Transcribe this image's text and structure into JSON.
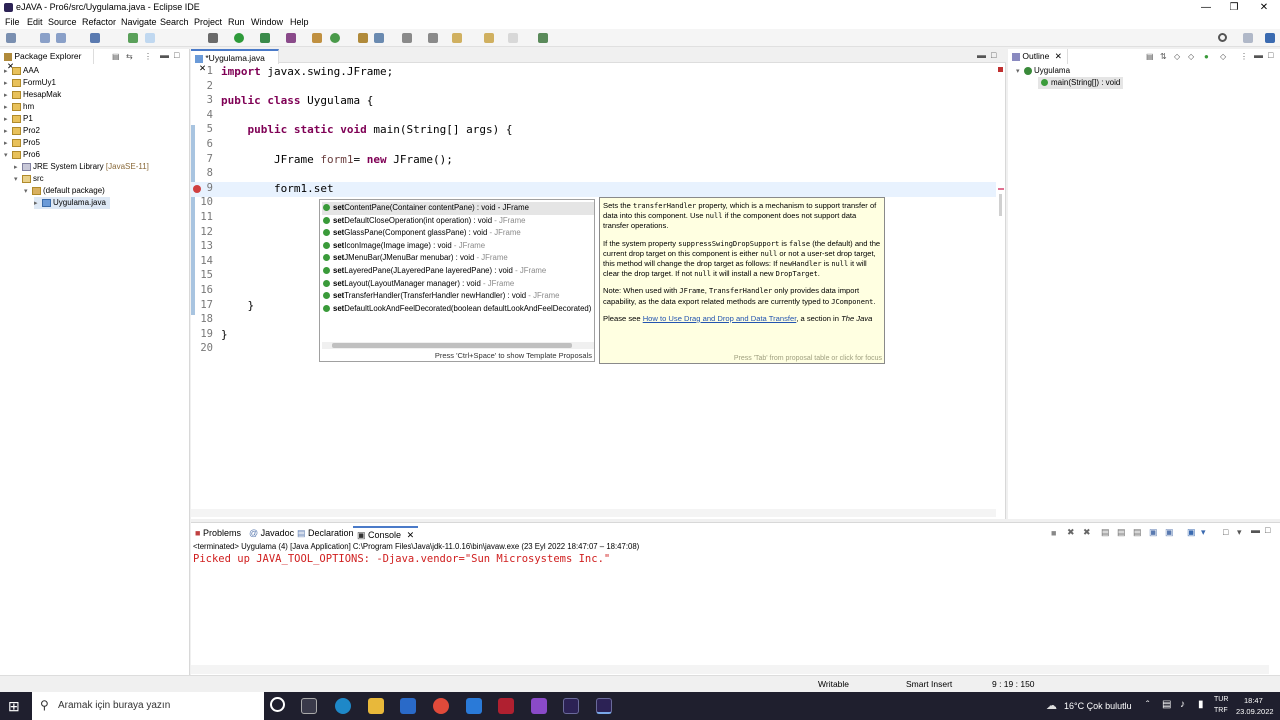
{
  "window": {
    "title": "eJAVA - Pro6/src/Uygulama.java - Eclipse IDE"
  },
  "menu": [
    "File",
    "Edit",
    "Source",
    "Refactor",
    "Navigate",
    "Search",
    "Project",
    "Run",
    "Window",
    "Help"
  ],
  "package_explorer": {
    "tab": "Package Explorer",
    "items": [
      {
        "label": "AAA"
      },
      {
        "label": "FormUy1"
      },
      {
        "label": "HesapMak"
      },
      {
        "label": "hm"
      },
      {
        "label": "P1"
      },
      {
        "label": "Pro2"
      },
      {
        "label": "Pro5"
      },
      {
        "label": "Pro6"
      },
      {
        "label": "JRE System Library",
        "suffix": "[JavaSE-11]"
      },
      {
        "label": "src"
      },
      {
        "label": "(default package)"
      },
      {
        "label": "Uygulama.java"
      }
    ]
  },
  "editor": {
    "tab": "*Uygulama.java",
    "lines": [
      {
        "n": "1",
        "text": "import javax.swing.JFrame;"
      },
      {
        "n": "2",
        "text": ""
      },
      {
        "n": "3",
        "text": "public class Uygulama {"
      },
      {
        "n": "4",
        "text": ""
      },
      {
        "n": "5",
        "text": "    public static void main(String[] args) {"
      },
      {
        "n": "6",
        "text": ""
      },
      {
        "n": "7",
        "text": "        JFrame form1= new JFrame();"
      },
      {
        "n": "8",
        "text": ""
      },
      {
        "n": "9",
        "text": "        form1.set"
      },
      {
        "n": "10",
        "text": ""
      },
      {
        "n": "11",
        "text": ""
      },
      {
        "n": "12",
        "text": ""
      },
      {
        "n": "13",
        "text": ""
      },
      {
        "n": "14",
        "text": ""
      },
      {
        "n": "15",
        "text": ""
      },
      {
        "n": "16",
        "text": ""
      },
      {
        "n": "17",
        "text": "    }"
      },
      {
        "n": "18",
        "text": ""
      },
      {
        "n": "19",
        "text": "}"
      },
      {
        "n": "20",
        "text": ""
      }
    ]
  },
  "completion": {
    "items": [
      {
        "prefix": "set",
        "name": "ContentPane(Container contentPane) : void",
        "type": " - JFrame"
      },
      {
        "prefix": "set",
        "name": "DefaultCloseOperation(int operation) : void",
        "type": " - JFrame"
      },
      {
        "prefix": "set",
        "name": "GlassPane(Component glassPane) : void",
        "type": " - JFrame"
      },
      {
        "prefix": "set",
        "name": "IconImage(Image image) : void",
        "type": " - JFrame"
      },
      {
        "prefix": "set",
        "name": "JMenuBar(JMenuBar menubar) : void",
        "type": " - JFrame"
      },
      {
        "prefix": "set",
        "name": "LayeredPane(JLayeredPane layeredPane) : void",
        "type": " - JFrame"
      },
      {
        "prefix": "set",
        "name": "Layout(LayoutManager manager) : void",
        "type": " - JFrame"
      },
      {
        "prefix": "set",
        "name": "TransferHandler(TransferHandler newHandler) : void",
        "type": " - JFrame"
      },
      {
        "prefix": "set",
        "name": "DefaultLookAndFeelDecorated(boolean defaultLookAndFeelDecorated)",
        "type": ""
      }
    ],
    "hint": "Press 'Ctrl+Space' to show Template Proposals"
  },
  "javadoc": {
    "p1a": "Sets the ",
    "p1code": "transferHandler",
    "p1b": " property, which is a mechanism to support transfer of data into this component. Use ",
    "p1null": "null",
    "p1c": " if the component does not support data transfer operations.",
    "p2a": "If the system property ",
    "p2code1": "suppressSwingDropSupport",
    "p2b": " is ",
    "p2false": "false",
    "p2c": " (the default) and the current drop target on this component is either ",
    "p2null1": "null",
    "p2d": " or not a user-set drop target, this method will change the drop target as follows: If ",
    "p2code2": "newHandler",
    "p2e": " is ",
    "p2null2": "null",
    "p2f": " it will clear the drop target. If not ",
    "p2null3": "null",
    "p2g": " it will install a new ",
    "p2code3": "DropTarget",
    "p2h": ".",
    "p3a": "Note: When used with ",
    "p3code1": "JFrame",
    "p3b": ", ",
    "p3code2": "TransferHandler",
    "p3c": " only provides data import capability, as the data export related methods are currently typed to ",
    "p3code3": "JComponent",
    "p3d": ".",
    "p4a": "Please see ",
    "p4link": "How to Use Drag and Drop and Data Transfer",
    "p4b": ", a section in ",
    "p4em": "The Java",
    "hint": "Press 'Tab' from proposal table or click for focus"
  },
  "outline": {
    "tab": "Outline",
    "class": "Uygulama",
    "method": "main(String[]) : void"
  },
  "console": {
    "tabs": [
      "Problems",
      "Javadoc",
      "Declaration",
      "Console"
    ],
    "header": "<terminated> Uygulama (4) [Java Application] C:\\Program Files\\Java\\jdk-11.0.16\\bin\\javaw.exe  (23 Eyl 2022 18:47:07 – 18:47:08)",
    "output": "Picked up JAVA_TOOL_OPTIONS: -Djava.vendor=\"Sun Microsystems Inc.\""
  },
  "status": {
    "writable": "Writable",
    "insert": "Smart Insert",
    "position": "9 : 19 : 150"
  },
  "taskbar": {
    "search_placeholder": "Aramak için buraya yazın",
    "weather": "16°C  Çok bulutlu",
    "lang1": "TUR",
    "lang2": "TRF",
    "time": "18:47",
    "date": "23.09.2022"
  }
}
